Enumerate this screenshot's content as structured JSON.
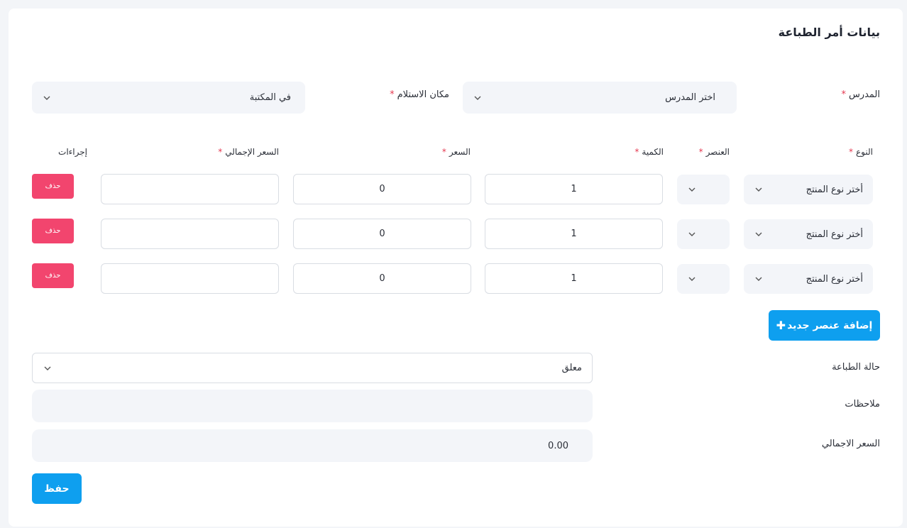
{
  "page": {
    "title": "بيانات أمر الطباعة",
    "required_mark": "*"
  },
  "header_fields": {
    "teacher_label": "المدرس",
    "teacher_value": "اختر المدرس",
    "pickup_label": "مكان الاستلام",
    "pickup_value": "في المكتبة"
  },
  "items_table": {
    "columns": {
      "type": "النوع",
      "item": "العنصر",
      "quantity": "الكمية",
      "price": "السعر",
      "total": "السعر الإجمالي",
      "actions": "إجراءات"
    },
    "rows": [
      {
        "type": "أختر نوع المنتج",
        "item": "",
        "quantity": "1",
        "price": "0",
        "total": "",
        "delete_label": "حذف"
      },
      {
        "type": "أختر نوع المنتج",
        "item": "",
        "quantity": "1",
        "price": "0",
        "total": "",
        "delete_label": "حذف"
      },
      {
        "type": "أختر نوع المنتج",
        "item": "",
        "quantity": "1",
        "price": "0",
        "total": "",
        "delete_label": "حذف"
      }
    ],
    "add_button_label": "إضافة عنصر جديد"
  },
  "footer_fields": {
    "status_label": "حالة الطباعة",
    "status_value": "معلق",
    "notes_label": "ملاحظات",
    "notes_value": "",
    "total_label": "السعر الاجمالي",
    "total_value": "0.00"
  },
  "actions": {
    "save_label": "حفظ"
  },
  "colors": {
    "primary": "#0e9fef",
    "danger": "#f2456e",
    "required": "#e53950"
  }
}
